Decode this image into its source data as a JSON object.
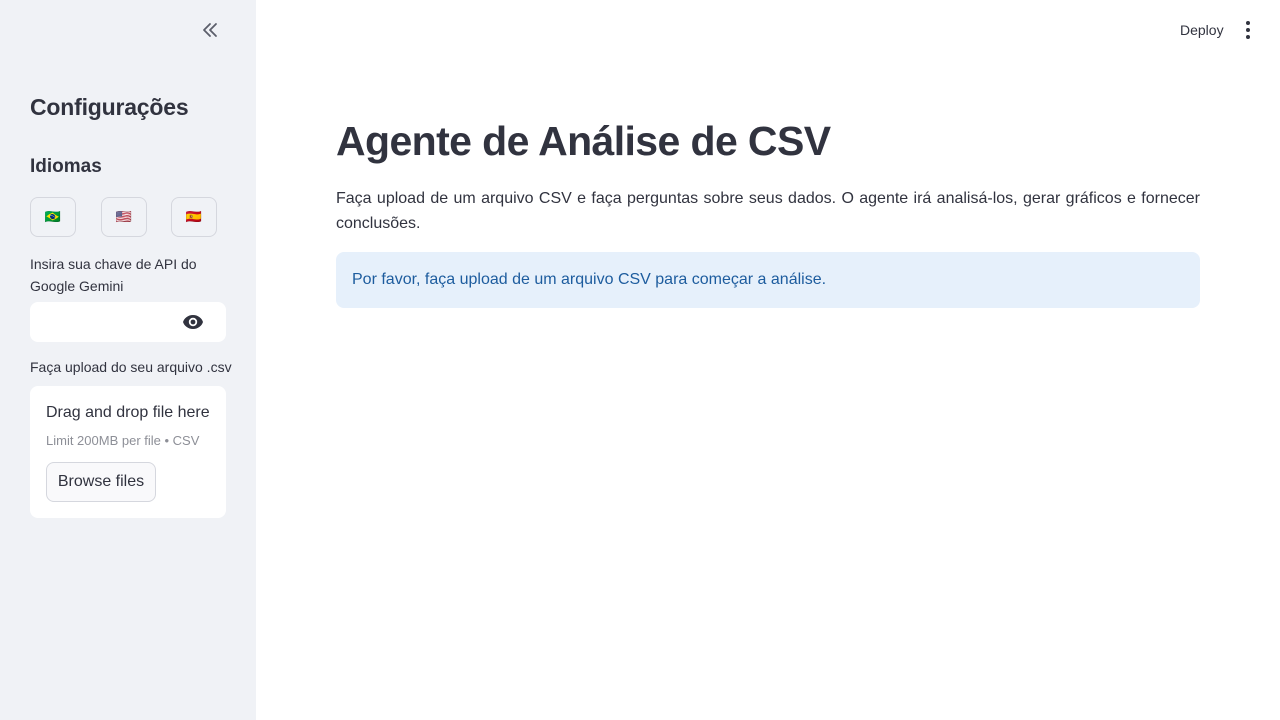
{
  "sidebar": {
    "collapse_glyph": "«",
    "title": "Configurações",
    "languages_title": "Idiomas",
    "language_buttons": [
      "🇧🇷",
      "🇺🇸",
      "🇪🇸"
    ],
    "api_key_label": "Insira sua chave de API do Google Gemini",
    "api_key_value": "",
    "upload_label": "Faça upload do seu arquivo .csv",
    "dropzone": {
      "title": "Drag and drop file here",
      "limit": "Limit 200MB per file • CSV",
      "browse_label": "Browse files"
    }
  },
  "header": {
    "deploy_label": "Deploy"
  },
  "main": {
    "title": "Agente de Análise de CSV",
    "intro": "Faça upload de um arquivo CSV e faça perguntas sobre seus dados. O agente irá analisá-los, gerar gráficos e fornecer conclusões.",
    "info": "Por favor, faça upload de um arquivo CSV para começar a análise."
  },
  "icons": {
    "collapse": "double-chevron-left-icon",
    "eye": "eye-icon",
    "menu": "vertical-dots-icon"
  },
  "colors": {
    "sidebar_bg": "#f0f2f6",
    "text": "#31333f",
    "info_bg": "#e6f0fb",
    "info_text": "#1d5c9e"
  }
}
